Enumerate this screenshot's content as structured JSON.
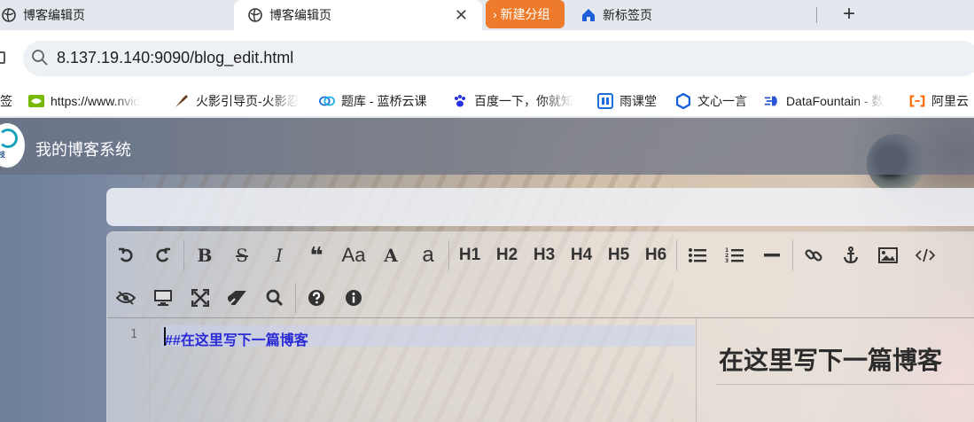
{
  "browser": {
    "tabs": [
      {
        "title": "博客编辑页",
        "icon": "globe-icon",
        "active": false
      },
      {
        "title": "博客编辑页",
        "icon": "globe-icon",
        "active": true,
        "close": "✕"
      }
    ],
    "group_chip": {
      "label": "› 新建分组",
      "color": "#ee7b2b"
    },
    "new_tab_page": {
      "title": "新标签页",
      "icon": "house-icon"
    },
    "new_tab_button": "+",
    "url": "8.137.19.140:9090/blog_edit.html",
    "bookmarks": [
      {
        "label": "签",
        "icon": "bookmark-icon"
      },
      {
        "label": "https://www.nvid",
        "icon": "nvidia-icon"
      },
      {
        "label": "火影引导页-火影忍",
        "icon": "brush-icon"
      },
      {
        "label": "题库 - 蓝桥云课",
        "icon": "lanqiao-icon"
      },
      {
        "label": "百度一下，你就知",
        "icon": "baidu-paw-icon"
      },
      {
        "label": "雨课堂",
        "icon": "rain-classroom-icon"
      },
      {
        "label": "文心一言",
        "icon": "wenxin-icon"
      },
      {
        "label": "DataFountain - 数",
        "icon": "datafountain-icon"
      },
      {
        "label": "阿里云",
        "icon": "aliyun-icon"
      }
    ]
  },
  "site": {
    "title": "我的博客系统",
    "logo_text": "科技"
  },
  "editor": {
    "toolbar_row1": {
      "undo": "undo-icon",
      "redo": "redo-icon",
      "bold": "B",
      "strike": "S",
      "italic": "I",
      "quote": "❝",
      "case_upper": "Aa",
      "case_a": "A",
      "case_lower": "a",
      "h1": "H1",
      "h2": "H2",
      "h3": "H3",
      "h4": "H4",
      "h5": "H5",
      "h6": "H6"
    },
    "line_number": "1",
    "code_line": "##在这里写下一篇博客",
    "preview_heading": "在这里写下一篇博客"
  }
}
